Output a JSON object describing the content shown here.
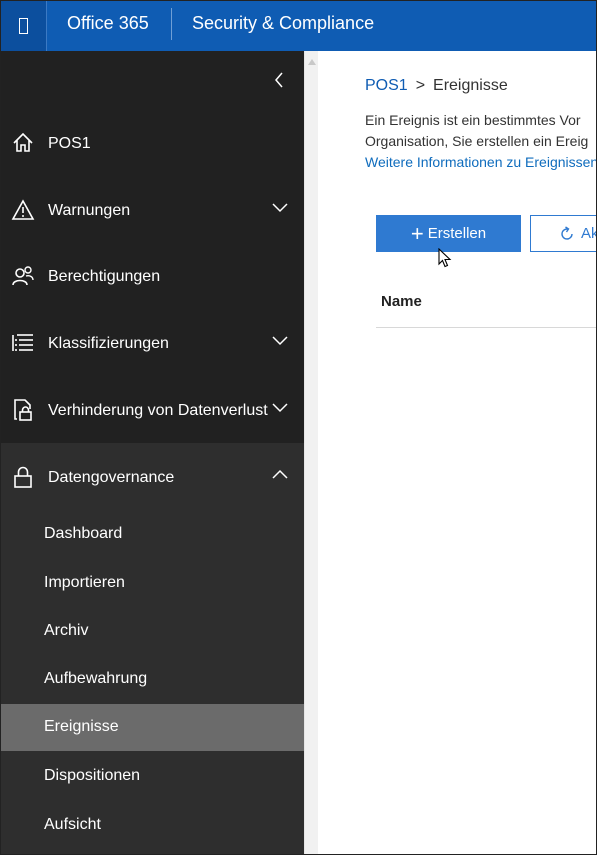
{
  "topbar": {
    "suite_title": "Office 365",
    "app_title": "Security & Compliance",
    "bg_color": "#0f5cb3"
  },
  "leftnav": {
    "collapse_icon": "chevron-left-icon",
    "items": [
      {
        "label": "POS1",
        "icon": "home-icon"
      },
      {
        "label": "Warnungen",
        "icon": "warning-icon",
        "expandable": true
      },
      {
        "label": "Berechtigungen",
        "icon": "people-icon"
      },
      {
        "label": "Klassifizierungen",
        "icon": "list-icon",
        "expandable": true
      },
      {
        "label": "Verhinderung von Datenverlust",
        "icon": "document-lock-icon",
        "expandable": true
      },
      {
        "label": "Datengovernance",
        "icon": "lock-icon",
        "expanded": true
      }
    ],
    "sub_items": [
      {
        "label": "Dashboard"
      },
      {
        "label": "Importieren"
      },
      {
        "label": "Archiv"
      },
      {
        "label": "Aufbewahrung"
      },
      {
        "label": "Ereignisse",
        "active": true
      },
      {
        "label": "Dispositionen"
      },
      {
        "label": "Aufsicht"
      }
    ]
  },
  "main": {
    "breadcrumb": {
      "root": "POS1",
      "separator": ">",
      "current": "Ereignisse"
    },
    "description": {
      "line1": "Ein Ereignis ist ein bestimmtes Vor",
      "line2": "Organisation, Sie erstellen ein Ereig",
      "link": "Weitere Informationen zu Ereignissen"
    },
    "toolbar": {
      "create_label": "Erstellen",
      "refresh_label": "Aktualisieren"
    },
    "table": {
      "columns": [
        "Name"
      ]
    }
  },
  "colors": {
    "accent": "#2f7ad1",
    "nav_bg": "#212121",
    "nav_group_bg": "#2e2e2e",
    "nav_active_bg": "#6b6b6b"
  }
}
